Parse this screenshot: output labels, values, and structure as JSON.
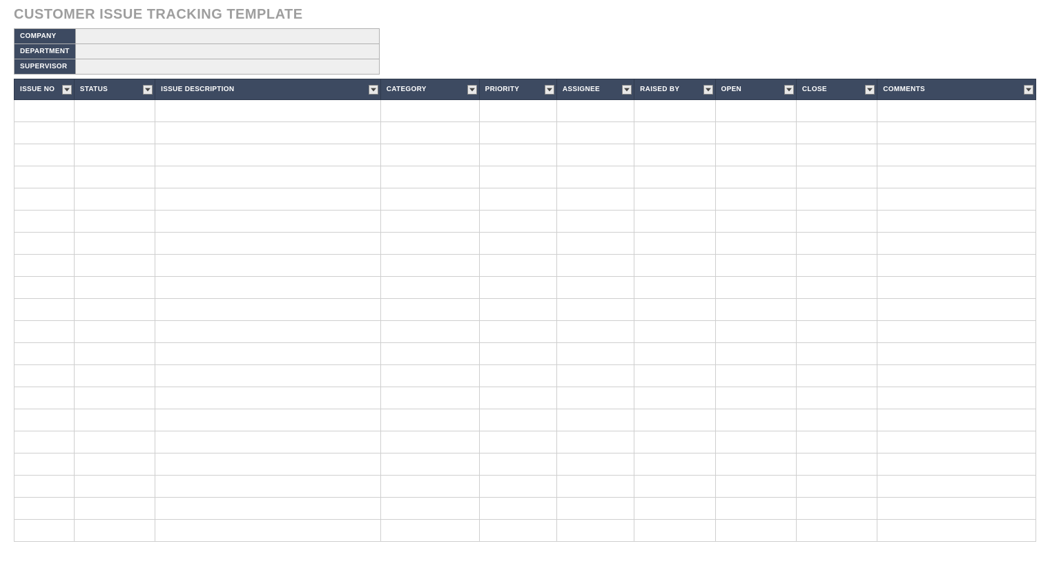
{
  "title": "CUSTOMER ISSUE TRACKING TEMPLATE",
  "info": {
    "company_label": "COMPANY",
    "company_value": "",
    "department_label": "DEPARTMENT",
    "department_value": "",
    "supervisor_label": "SUPERVISOR",
    "supervisor_value": ""
  },
  "columns": {
    "issue_no": "ISSUE NO",
    "status": "STATUS",
    "issue_description": "ISSUE DESCRIPTION",
    "category": "CATEGORY",
    "priority": "PRIORITY",
    "assignee": "ASSIGNEE",
    "raised_by": "RAISED BY",
    "open": "OPEN",
    "close": "CLOSE",
    "comments": "COMMENTS"
  },
  "rows": [
    {
      "issue_no": "",
      "status": "",
      "issue_description": "",
      "category": "",
      "priority": "",
      "assignee": "",
      "raised_by": "",
      "open": "",
      "close": "",
      "comments": ""
    },
    {
      "issue_no": "",
      "status": "",
      "issue_description": "",
      "category": "",
      "priority": "",
      "assignee": "",
      "raised_by": "",
      "open": "",
      "close": "",
      "comments": ""
    },
    {
      "issue_no": "",
      "status": "",
      "issue_description": "",
      "category": "",
      "priority": "",
      "assignee": "",
      "raised_by": "",
      "open": "",
      "close": "",
      "comments": ""
    },
    {
      "issue_no": "",
      "status": "",
      "issue_description": "",
      "category": "",
      "priority": "",
      "assignee": "",
      "raised_by": "",
      "open": "",
      "close": "",
      "comments": ""
    },
    {
      "issue_no": "",
      "status": "",
      "issue_description": "",
      "category": "",
      "priority": "",
      "assignee": "",
      "raised_by": "",
      "open": "",
      "close": "",
      "comments": ""
    },
    {
      "issue_no": "",
      "status": "",
      "issue_description": "",
      "category": "",
      "priority": "",
      "assignee": "",
      "raised_by": "",
      "open": "",
      "close": "",
      "comments": ""
    },
    {
      "issue_no": "",
      "status": "",
      "issue_description": "",
      "category": "",
      "priority": "",
      "assignee": "",
      "raised_by": "",
      "open": "",
      "close": "",
      "comments": ""
    },
    {
      "issue_no": "",
      "status": "",
      "issue_description": "",
      "category": "",
      "priority": "",
      "assignee": "",
      "raised_by": "",
      "open": "",
      "close": "",
      "comments": ""
    },
    {
      "issue_no": "",
      "status": "",
      "issue_description": "",
      "category": "",
      "priority": "",
      "assignee": "",
      "raised_by": "",
      "open": "",
      "close": "",
      "comments": ""
    },
    {
      "issue_no": "",
      "status": "",
      "issue_description": "",
      "category": "",
      "priority": "",
      "assignee": "",
      "raised_by": "",
      "open": "",
      "close": "",
      "comments": ""
    },
    {
      "issue_no": "",
      "status": "",
      "issue_description": "",
      "category": "",
      "priority": "",
      "assignee": "",
      "raised_by": "",
      "open": "",
      "close": "",
      "comments": ""
    },
    {
      "issue_no": "",
      "status": "",
      "issue_description": "",
      "category": "",
      "priority": "",
      "assignee": "",
      "raised_by": "",
      "open": "",
      "close": "",
      "comments": ""
    },
    {
      "issue_no": "",
      "status": "",
      "issue_description": "",
      "category": "",
      "priority": "",
      "assignee": "",
      "raised_by": "",
      "open": "",
      "close": "",
      "comments": ""
    },
    {
      "issue_no": "",
      "status": "",
      "issue_description": "",
      "category": "",
      "priority": "",
      "assignee": "",
      "raised_by": "",
      "open": "",
      "close": "",
      "comments": ""
    },
    {
      "issue_no": "",
      "status": "",
      "issue_description": "",
      "category": "",
      "priority": "",
      "assignee": "",
      "raised_by": "",
      "open": "",
      "close": "",
      "comments": ""
    },
    {
      "issue_no": "",
      "status": "",
      "issue_description": "",
      "category": "",
      "priority": "",
      "assignee": "",
      "raised_by": "",
      "open": "",
      "close": "",
      "comments": ""
    },
    {
      "issue_no": "",
      "status": "",
      "issue_description": "",
      "category": "",
      "priority": "",
      "assignee": "",
      "raised_by": "",
      "open": "",
      "close": "",
      "comments": ""
    },
    {
      "issue_no": "",
      "status": "",
      "issue_description": "",
      "category": "",
      "priority": "",
      "assignee": "",
      "raised_by": "",
      "open": "",
      "close": "",
      "comments": ""
    },
    {
      "issue_no": "",
      "status": "",
      "issue_description": "",
      "category": "",
      "priority": "",
      "assignee": "",
      "raised_by": "",
      "open": "",
      "close": "",
      "comments": ""
    },
    {
      "issue_no": "",
      "status": "",
      "issue_description": "",
      "category": "",
      "priority": "",
      "assignee": "",
      "raised_by": "",
      "open": "",
      "close": "",
      "comments": ""
    }
  ]
}
